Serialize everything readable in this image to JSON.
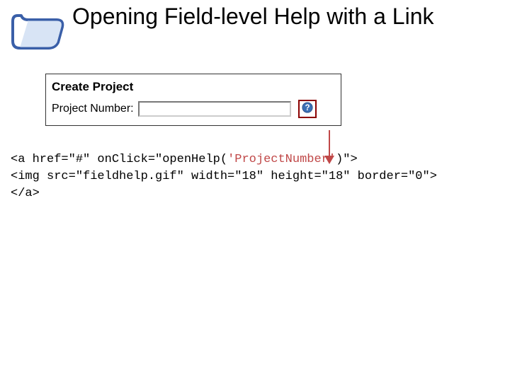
{
  "title": "Opening Field-level Help with a Link",
  "form": {
    "heading": "Create Project",
    "field_label": "Project Number:"
  },
  "code": {
    "line1_pre": "<a href=\"#\" onClick=\"openHelp(",
    "line1_mid": "'ProjectNumber'",
    "line1_post": ")\">",
    "line2": "<img src=\"fieldhelp.gif\" width=\"18\" height=\"18\" border=\"0\">",
    "line3": "</a>"
  }
}
